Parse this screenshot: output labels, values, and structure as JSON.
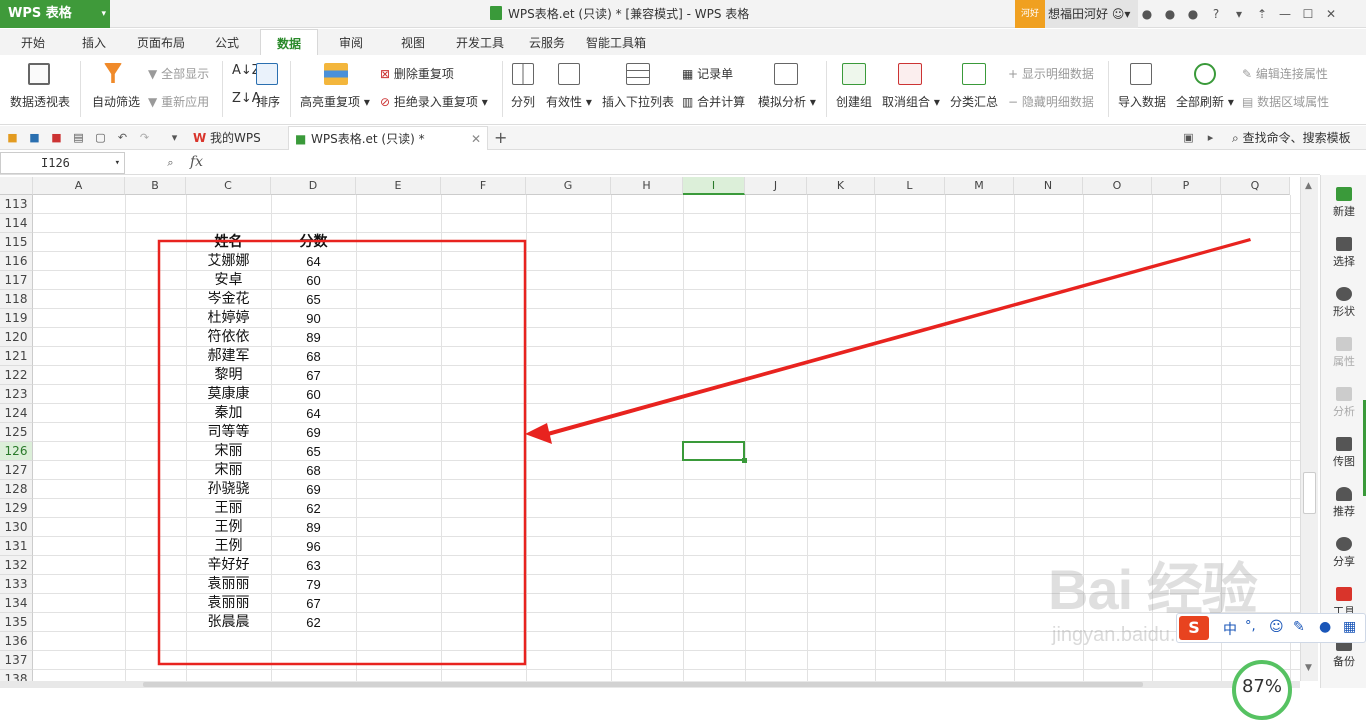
{
  "app": {
    "name": "WPS 表格",
    "window_title": "WPS表格.et (只读) * [兼容模式] - WPS 表格",
    "user_badge": "河好",
    "user_name": "想福田河好"
  },
  "menu_tabs": [
    "开始",
    "插入",
    "页面布局",
    "公式",
    "数据",
    "审阅",
    "视图",
    "开发工具",
    "云服务",
    "智能工具箱"
  ],
  "active_menu_tab": "数据",
  "ribbon": {
    "pivot": "数据透视表",
    "autofilter": "自动筛选",
    "show_all": "全部显示",
    "reapply": "重新应用",
    "sort": "排序",
    "highlight_dup": "高亮重复项",
    "remove_dup": "删除重复项",
    "reject_dup": "拒绝录入重复项",
    "split": "分列",
    "validity": "有效性",
    "dropdown": "插入下拉列表",
    "record_form": "记录单",
    "consolidate": "合并计算",
    "what_if": "模拟分析",
    "group": "创建组",
    "ungroup": "取消组合",
    "subtotal": "分类汇总",
    "show_detail": "显示明细数据",
    "hide_detail": "隐藏明细数据",
    "import": "导入数据",
    "refresh_all": "全部刷新",
    "edit_link": "编辑连接属性",
    "range_prop": "数据区域属性"
  },
  "doc_tabs": {
    "home": "我的WPS",
    "file": "WPS表格.et (只读) *"
  },
  "search_cmd": "查找命令、搜索模板",
  "formula_bar": {
    "cell_ref": "I126",
    "fx": "fx"
  },
  "columns": [
    "A",
    "B",
    "C",
    "D",
    "E",
    "F",
    "G",
    "H",
    "I",
    "J",
    "K",
    "L",
    "M",
    "N",
    "O",
    "P",
    "Q"
  ],
  "rows": [
    "113",
    "114",
    "115",
    "116",
    "117",
    "118",
    "119",
    "120",
    "121",
    "122",
    "123",
    "124",
    "125",
    "126",
    "127",
    "128",
    "129",
    "130",
    "131",
    "132",
    "133",
    "134",
    "135",
    "136",
    "137",
    "138"
  ],
  "table": {
    "headers": [
      "姓名",
      "分数"
    ],
    "names": [
      "艾娜娜",
      "安卓",
      "岑金花",
      "杜婷婷",
      "符依依",
      "郝建军",
      "黎明",
      "莫康康",
      "秦加",
      "司等等",
      "宋丽",
      "宋丽",
      "孙骁骁",
      "王丽",
      "王例",
      "王例",
      "辛好好",
      "袁丽丽",
      "袁丽丽",
      "张晨晨"
    ],
    "scores": [
      "64",
      "60",
      "65",
      "90",
      "89",
      "68",
      "67",
      "60",
      "64",
      "69",
      "65",
      "68",
      "69",
      "62",
      "89",
      "96",
      "63",
      "79",
      "67",
      "62"
    ]
  },
  "sidebar": [
    "新建",
    "选择",
    "形状",
    "属性",
    "分析",
    "传图",
    "推荐",
    "分享",
    "工具",
    "备份"
  ],
  "zoom": "87%",
  "watermark": {
    "main": "Bai 经验",
    "sub": "jingyan.baidu.com"
  },
  "ime": {
    "lang": "中"
  },
  "colors": {
    "accent": "#3f9a3a",
    "annotation": "#e8231f"
  }
}
